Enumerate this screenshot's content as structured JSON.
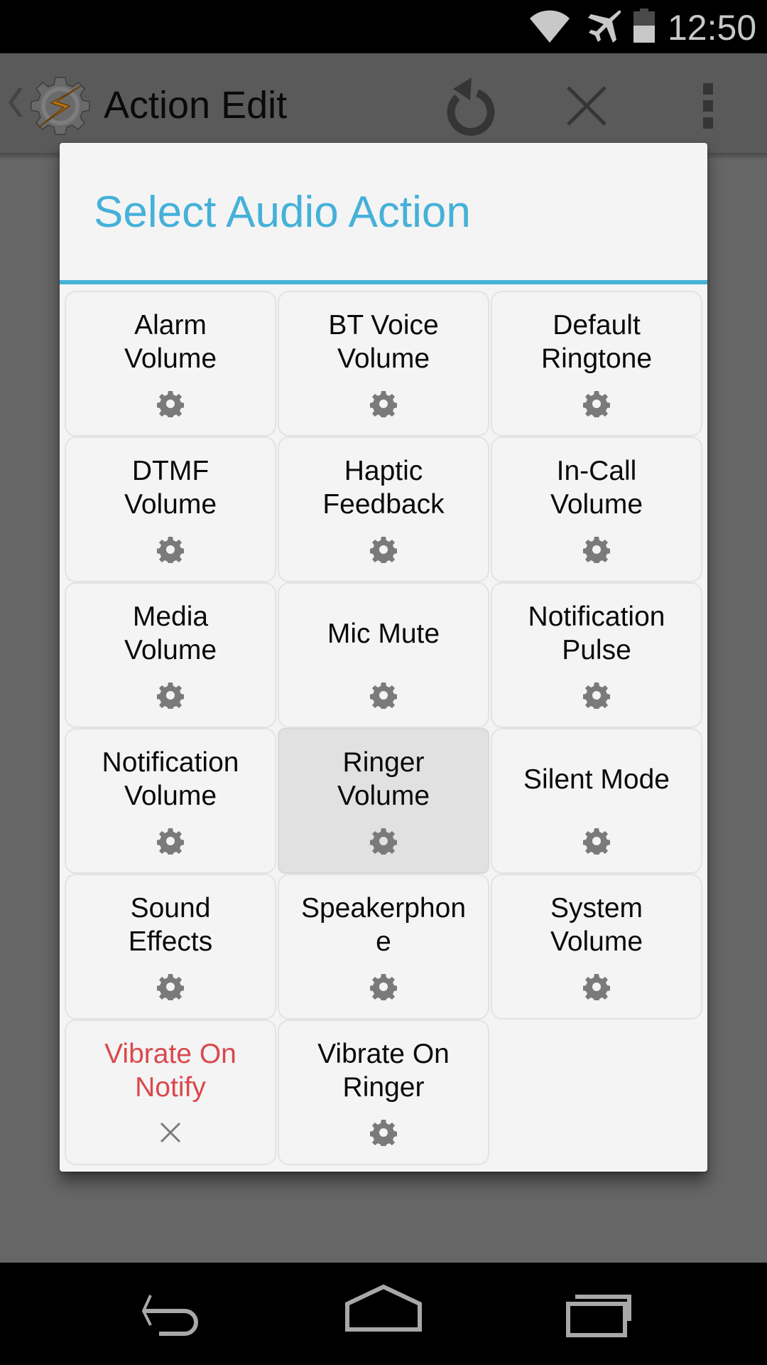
{
  "status_bar": {
    "time": "12:50",
    "icons": [
      "wifi-icon",
      "airplane-mode-icon",
      "battery-icon"
    ],
    "battery_level": 0.5
  },
  "action_bar": {
    "title": "Action Edit",
    "icons": [
      "back-chevron-icon",
      "app-logo-icon",
      "undo-icon",
      "close-icon",
      "overflow-menu-icon"
    ]
  },
  "dialog": {
    "title": "Select Audio Action",
    "accent_color": "#45b1d8",
    "items": [
      {
        "label": "Alarm Volume",
        "icon": "gear-icon",
        "selected": false,
        "error": false
      },
      {
        "label": "BT Voice Volume",
        "icon": "gear-icon",
        "selected": false,
        "error": false
      },
      {
        "label": "Default Ringtone",
        "icon": "gear-icon",
        "selected": false,
        "error": false
      },
      {
        "label": "DTMF Volume",
        "icon": "gear-icon",
        "selected": false,
        "error": false
      },
      {
        "label": "Haptic Feedback",
        "icon": "gear-icon",
        "selected": false,
        "error": false
      },
      {
        "label": "In-Call Volume",
        "icon": "gear-icon",
        "selected": false,
        "error": false
      },
      {
        "label": "Media Volume",
        "icon": "gear-icon",
        "selected": false,
        "error": false
      },
      {
        "label": "Mic Mute",
        "icon": "gear-icon",
        "selected": false,
        "error": false
      },
      {
        "label": "Notification Pulse",
        "icon": "gear-icon",
        "selected": false,
        "error": false
      },
      {
        "label": "Notification Volume",
        "icon": "gear-icon",
        "selected": false,
        "error": false
      },
      {
        "label": "Ringer Volume",
        "icon": "gear-icon",
        "selected": true,
        "error": false
      },
      {
        "label": "Silent Mode",
        "icon": "gear-icon",
        "selected": false,
        "error": false
      },
      {
        "label": "Sound Effects",
        "icon": "gear-icon",
        "selected": false,
        "error": false
      },
      {
        "label": "Speakerphone",
        "icon": "gear-icon",
        "selected": false,
        "error": false
      },
      {
        "label": "System Volume",
        "icon": "gear-icon",
        "selected": false,
        "error": false
      },
      {
        "label": "Vibrate On Notify",
        "icon": "close-x-icon",
        "selected": false,
        "error": true
      },
      {
        "label": "Vibrate On Ringer",
        "icon": "gear-icon",
        "selected": false,
        "error": false
      }
    ],
    "error_color": "#d9494c"
  },
  "nav_bar": {
    "buttons": [
      "back",
      "home",
      "recents"
    ]
  }
}
